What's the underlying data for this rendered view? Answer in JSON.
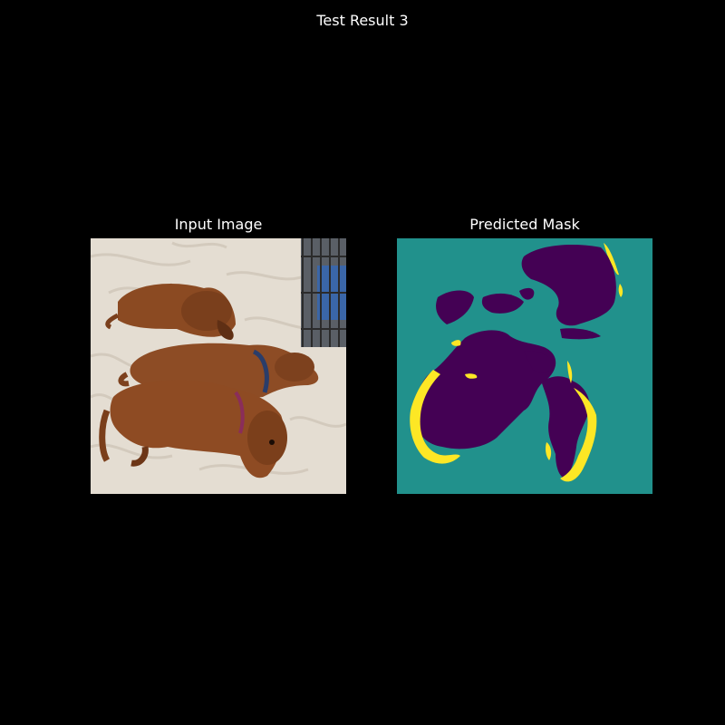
{
  "figure": {
    "title": "Test Result 3"
  },
  "panels": {
    "input": {
      "title": "Input Image"
    },
    "mask": {
      "title": "Predicted Mask"
    }
  },
  "colors": {
    "background": "#000000",
    "text": "#ffffff",
    "mask_background": "#21918c",
    "mask_object": "#440154",
    "mask_boundary": "#fde725",
    "dog_fur": "#8a4b24",
    "blanket": "#e6e0d6"
  }
}
